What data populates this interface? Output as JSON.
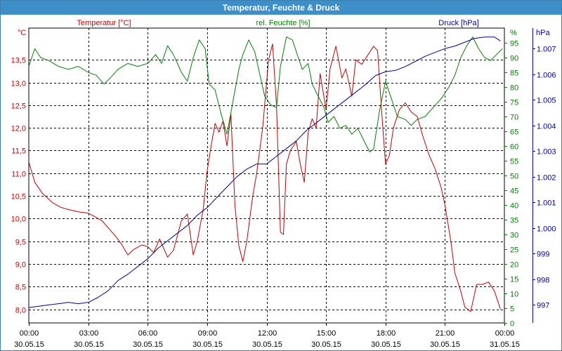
{
  "window": {
    "title": "Temperatur, Feuchte & Druck"
  },
  "colors": {
    "temperature": "#c00000",
    "humidity": "#008000",
    "pressure": "#000090",
    "grid": "#000000",
    "titlebar": "#3d8ec9"
  },
  "chart_data": {
    "type": "line",
    "title": "Temperatur, Feuchte & Druck",
    "grid": true,
    "x_ticks": [
      {
        "time": "00:00",
        "date": "30.05.15"
      },
      {
        "time": "03:00",
        "date": "30.05.15"
      },
      {
        "time": "06:00",
        "date": "30.05.15"
      },
      {
        "time": "09:00",
        "date": "30.05.15"
      },
      {
        "time": "12:00",
        "date": "30.05.15"
      },
      {
        "time": "15:00",
        "date": "30.05.15"
      },
      {
        "time": "18:00",
        "date": "30.05.15"
      },
      {
        "time": "21:00",
        "date": "30.05.15"
      },
      {
        "time": "00:00",
        "date": "31.05.15"
      }
    ],
    "x_range_hours": [
      0,
      24
    ],
    "axes": {
      "temperature": {
        "label": "Temperatur [°C]",
        "unit": "°C",
        "min": 7.7,
        "max": 14.2,
        "ticks": [
          8.0,
          8.5,
          9.0,
          9.5,
          10.0,
          10.5,
          11.0,
          11.5,
          12.0,
          12.5,
          13.0,
          13.5
        ],
        "tick_labels": [
          "8,0",
          "8,5",
          "9,0",
          "9,5",
          "10,0",
          "10,5",
          "11,0",
          "11,5",
          "12,0",
          "12,5",
          "13,0",
          "13,5"
        ]
      },
      "humidity": {
        "label": "rel. Feuchte [%]",
        "unit": "%",
        "min": 0,
        "max": 100,
        "ticks": [
          0,
          5,
          10,
          15,
          20,
          25,
          30,
          35,
          40,
          45,
          50,
          55,
          60,
          65,
          70,
          75,
          80,
          85,
          90,
          95
        ],
        "tick_labels": [
          "0",
          "5",
          "10",
          "15",
          "20",
          "25",
          "30",
          "35",
          "40",
          "45",
          "50",
          "55",
          "60",
          "65",
          "70",
          "75",
          "80",
          "85",
          "90",
          "95"
        ]
      },
      "pressure": {
        "label": "Druck [hPa]",
        "unit": "hPa",
        "min": 996.3,
        "max": 1007.8,
        "ticks": [
          997,
          998,
          999,
          1000,
          1001,
          1002,
          1003,
          1004,
          1005,
          1006,
          1007
        ],
        "tick_labels": [
          "997",
          "998",
          "999",
          "1.000",
          "1.001",
          "1.002",
          "1.003",
          "1.004",
          "1.005",
          "1.006",
          "1.007"
        ]
      }
    },
    "series": [
      {
        "name": "Temperatur [°C]",
        "axis": "temperature",
        "color": "#c00000",
        "points": [
          [
            0,
            11.25
          ],
          [
            0.3,
            10.8
          ],
          [
            0.7,
            10.55
          ],
          [
            1.2,
            10.35
          ],
          [
            1.6,
            10.25
          ],
          [
            2.0,
            10.2
          ],
          [
            2.5,
            10.15
          ],
          [
            3.0,
            10.12
          ],
          [
            3.3,
            10.05
          ],
          [
            3.7,
            9.95
          ],
          [
            4.0,
            9.8
          ],
          [
            4.4,
            9.6
          ],
          [
            4.7,
            9.42
          ],
          [
            5.0,
            9.2
          ],
          [
            5.3,
            9.32
          ],
          [
            5.7,
            9.42
          ],
          [
            6.0,
            9.38
          ],
          [
            6.3,
            9.25
          ],
          [
            6.6,
            9.55
          ],
          [
            7.0,
            9.15
          ],
          [
            7.3,
            9.3
          ],
          [
            7.7,
            9.95
          ],
          [
            8.0,
            10.1
          ],
          [
            8.3,
            9.2
          ],
          [
            8.5,
            9.5
          ],
          [
            8.8,
            10.2
          ],
          [
            9.0,
            11.05
          ],
          [
            9.2,
            11.6
          ],
          [
            9.4,
            12.1
          ],
          [
            9.6,
            11.9
          ],
          [
            9.8,
            12.15
          ],
          [
            10.0,
            11.6
          ],
          [
            10.2,
            12.3
          ],
          [
            10.4,
            10.3
          ],
          [
            10.6,
            9.4
          ],
          [
            10.8,
            9.05
          ],
          [
            11.0,
            9.5
          ],
          [
            11.3,
            10.5
          ],
          [
            11.5,
            11.0
          ],
          [
            11.8,
            12.0
          ],
          [
            12.1,
            13.5
          ],
          [
            12.3,
            13.85
          ],
          [
            12.5,
            12.5
          ],
          [
            12.7,
            9.7
          ],
          [
            12.85,
            9.65
          ],
          [
            13.0,
            11.2
          ],
          [
            13.2,
            11.5
          ],
          [
            13.5,
            11.7
          ],
          [
            13.7,
            11.2
          ],
          [
            13.9,
            10.8
          ],
          [
            14.1,
            11.9
          ],
          [
            14.3,
            12.2
          ],
          [
            14.5,
            12.0
          ],
          [
            14.7,
            13.2
          ],
          [
            15.0,
            12.4
          ],
          [
            15.2,
            13.3
          ],
          [
            15.5,
            13.8
          ],
          [
            15.8,
            13.1
          ],
          [
            16.0,
            13.3
          ],
          [
            16.3,
            12.7
          ],
          [
            16.5,
            13.5
          ],
          [
            16.8,
            13.4
          ],
          [
            17.1,
            13.6
          ],
          [
            17.4,
            13.8
          ],
          [
            17.6,
            13.7
          ],
          [
            17.8,
            12.4
          ],
          [
            18.0,
            11.2
          ],
          [
            18.2,
            11.4
          ],
          [
            18.4,
            12.0
          ],
          [
            18.7,
            12.4
          ],
          [
            19.0,
            12.55
          ],
          [
            19.3,
            12.35
          ],
          [
            19.6,
            12.25
          ],
          [
            19.9,
            11.8
          ],
          [
            20.2,
            11.4
          ],
          [
            20.5,
            11.1
          ],
          [
            20.8,
            10.7
          ],
          [
            21.0,
            10.3
          ],
          [
            21.3,
            9.5
          ],
          [
            21.5,
            8.8
          ],
          [
            21.8,
            8.4
          ],
          [
            22.0,
            8.05
          ],
          [
            22.3,
            7.95
          ],
          [
            22.6,
            8.55
          ],
          [
            22.9,
            8.55
          ],
          [
            23.2,
            8.6
          ],
          [
            23.5,
            8.4
          ],
          [
            23.8,
            8.0
          ]
        ]
      },
      {
        "name": "rel. Feuchte [%]",
        "axis": "humidity",
        "color": "#008000",
        "points": [
          [
            0,
            87
          ],
          [
            0.3,
            93
          ],
          [
            0.6,
            90
          ],
          [
            1.0,
            89
          ],
          [
            1.5,
            87
          ],
          [
            2.0,
            86
          ],
          [
            2.5,
            87
          ],
          [
            3.0,
            85
          ],
          [
            3.4,
            84
          ],
          [
            3.8,
            81
          ],
          [
            4.1,
            83
          ],
          [
            4.5,
            86
          ],
          [
            5.0,
            88
          ],
          [
            5.5,
            87
          ],
          [
            6.0,
            88
          ],
          [
            6.4,
            91
          ],
          [
            6.7,
            88
          ],
          [
            7.0,
            94
          ],
          [
            7.3,
            91
          ],
          [
            7.7,
            85
          ],
          [
            8.0,
            82
          ],
          [
            8.3,
            90
          ],
          [
            8.6,
            96
          ],
          [
            8.9,
            93
          ],
          [
            9.1,
            81
          ],
          [
            9.4,
            79
          ],
          [
            9.7,
            71
          ],
          [
            10.0,
            64
          ],
          [
            10.3,
            75
          ],
          [
            10.6,
            86
          ],
          [
            10.8,
            91
          ],
          [
            11.1,
            96
          ],
          [
            11.4,
            92
          ],
          [
            11.6,
            86
          ],
          [
            11.9,
            77
          ],
          [
            12.2,
            74
          ],
          [
            12.5,
            73
          ],
          [
            12.7,
            87
          ],
          [
            13.0,
            97
          ],
          [
            13.3,
            96
          ],
          [
            13.6,
            90
          ],
          [
            13.8,
            86
          ],
          [
            14.1,
            88
          ],
          [
            14.3,
            81
          ],
          [
            14.6,
            77
          ],
          [
            14.9,
            73
          ],
          [
            15.1,
            68
          ],
          [
            15.4,
            70
          ],
          [
            15.7,
            66
          ],
          [
            16.0,
            67
          ],
          [
            16.3,
            64
          ],
          [
            16.6,
            66
          ],
          [
            16.9,
            62
          ],
          [
            17.2,
            58
          ],
          [
            17.4,
            59
          ],
          [
            17.7,
            72
          ],
          [
            18.0,
            82
          ],
          [
            18.3,
            76
          ],
          [
            18.6,
            70
          ],
          [
            19.0,
            69
          ],
          [
            19.3,
            67
          ],
          [
            19.6,
            69
          ],
          [
            20.0,
            70
          ],
          [
            20.4,
            73
          ],
          [
            20.8,
            76
          ],
          [
            21.2,
            80
          ],
          [
            21.5,
            84
          ],
          [
            21.8,
            90
          ],
          [
            22.1,
            94
          ],
          [
            22.4,
            97
          ],
          [
            22.7,
            93
          ],
          [
            23.0,
            90
          ],
          [
            23.3,
            89
          ],
          [
            23.6,
            91
          ],
          [
            23.9,
            93
          ]
        ]
      },
      {
        "name": "Druck [hPa]",
        "axis": "pressure",
        "color": "#000090",
        "points": [
          [
            0,
            996.9
          ],
          [
            0.5,
            996.95
          ],
          [
            1.0,
            997.0
          ],
          [
            1.5,
            997.05
          ],
          [
            2.0,
            997.1
          ],
          [
            2.5,
            997.05
          ],
          [
            3.0,
            997.1
          ],
          [
            3.5,
            997.3
          ],
          [
            4.0,
            997.55
          ],
          [
            4.5,
            997.95
          ],
          [
            5.0,
            998.2
          ],
          [
            5.5,
            998.5
          ],
          [
            6.0,
            998.8
          ],
          [
            6.5,
            999.2
          ],
          [
            7.0,
            999.5
          ],
          [
            7.5,
            999.8
          ],
          [
            8.0,
            1000.1
          ],
          [
            8.5,
            1000.5
          ],
          [
            9.0,
            1000.8
          ],
          [
            9.5,
            1001.2
          ],
          [
            10.0,
            1001.6
          ],
          [
            10.5,
            1002.0
          ],
          [
            11.0,
            1002.3
          ],
          [
            11.5,
            1002.5
          ],
          [
            12.0,
            1002.5
          ],
          [
            12.5,
            1002.8
          ],
          [
            13.0,
            1003.1
          ],
          [
            13.5,
            1003.4
          ],
          [
            14.0,
            1003.8
          ],
          [
            14.5,
            1004.1
          ],
          [
            15.0,
            1004.4
          ],
          [
            15.5,
            1004.7
          ],
          [
            16.0,
            1005.0
          ],
          [
            16.5,
            1005.3
          ],
          [
            17.0,
            1005.6
          ],
          [
            17.5,
            1005.95
          ],
          [
            18.0,
            1006.1
          ],
          [
            18.5,
            1006.15
          ],
          [
            19.0,
            1006.3
          ],
          [
            19.5,
            1006.5
          ],
          [
            20.0,
            1006.7
          ],
          [
            20.5,
            1006.85
          ],
          [
            21.0,
            1007.0
          ],
          [
            21.5,
            1007.1
          ],
          [
            22.0,
            1007.25
          ],
          [
            22.5,
            1007.4
          ],
          [
            23.0,
            1007.45
          ],
          [
            23.5,
            1007.45
          ],
          [
            23.8,
            1007.3
          ]
        ]
      }
    ]
  }
}
